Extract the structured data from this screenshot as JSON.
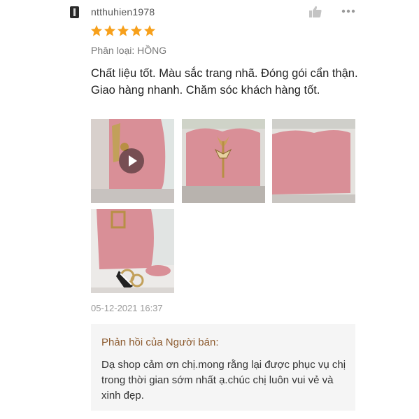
{
  "review": {
    "username": "ntthuhien1978",
    "rating": 5,
    "variation": "Phân loại: HỒNG",
    "comment": "Chất liệu tốt. Màu sắc trang nhã. Đóng gói cẩn thận. Giao hàng nhanh. Chăm sóc khách hàng tốt.",
    "timestamp": "05-12-2021 16:37"
  },
  "icons": {
    "like": "thumbs-up-icon",
    "more": "more-icon",
    "star": "star-icon",
    "play": "play-icon"
  },
  "colors": {
    "star": "#f7a01b",
    "reply_title": "#8c5a2e",
    "reply_bg": "#f5f5f5",
    "product_pink": "#d98f97"
  },
  "seller_reply": {
    "title": "Phản hồi của Người bán:",
    "text": "Dạ shop cảm ơn chị.mong rằng lại được phục vụ chị trong thời gian sớm nhất ạ.chúc chị luôn vui vẻ và xinh đẹp."
  }
}
